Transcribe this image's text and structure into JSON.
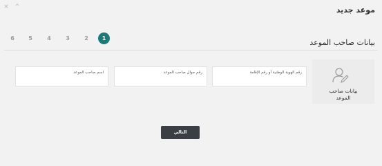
{
  "window": {
    "close_icon": "×",
    "collapse_icon": "^"
  },
  "modal": {
    "title": "موعد جديد"
  },
  "steps": {
    "items": [
      "1",
      "2",
      "3",
      "4",
      "5",
      "6"
    ],
    "active": "1"
  },
  "section": {
    "heading": "بيانات صاحب الموعد"
  },
  "side_panel": {
    "label_line1": "بيانات صاحب",
    "label_line2": "الموعد",
    "icon": "user-edit-icon"
  },
  "fields": {
    "national_id": {
      "placeholder": "رقم الهوية الوطنية أو رقم الإقامة"
    },
    "mobile": {
      "placeholder": "رقم جوال صاحب الموعد"
    },
    "name": {
      "placeholder": "اسم صاحب الموعد"
    }
  },
  "actions": {
    "next_label": "التالي"
  },
  "colors": {
    "accent": "#1e7a78",
    "button": "#3b3f45",
    "background": "#f2f2f2"
  }
}
